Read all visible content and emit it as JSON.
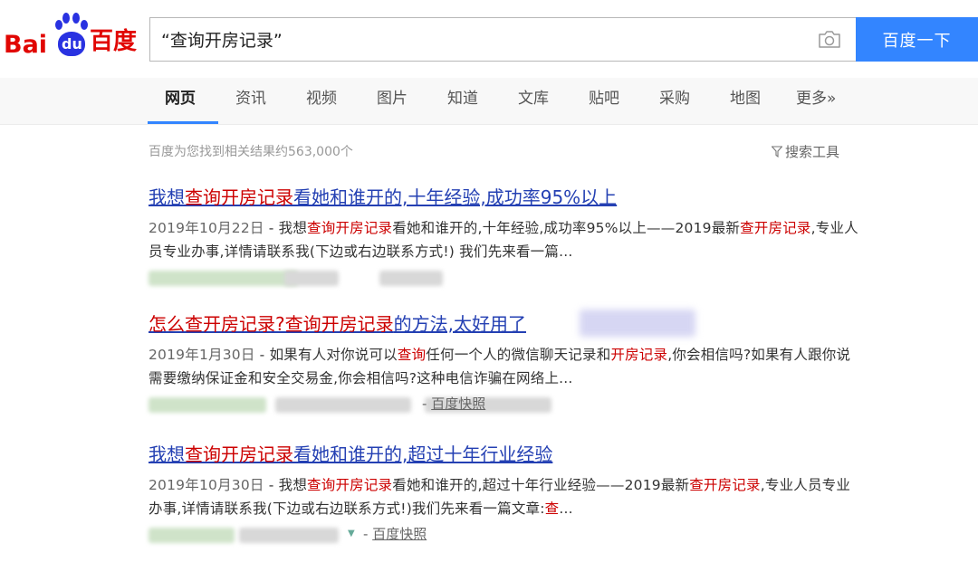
{
  "logo": {
    "bai": "Bai",
    "du": "du",
    "cn": "百度"
  },
  "search": {
    "query": "“查询开房记录”",
    "button": "百度一下"
  },
  "tabs": [
    "网页",
    "资讯",
    "视频",
    "图片",
    "知道",
    "文库",
    "贴吧",
    "采购",
    "地图",
    "更多»"
  ],
  "result_count": "百度为您找到相关结果约563,000个",
  "tools": "搜索工具",
  "results": [
    {
      "title": [
        {
          "t": "我想",
          "em": false
        },
        {
          "t": "查询开房记录",
          "em": true
        },
        {
          "t": "看她和谁开的,十年经验,成功率95%以上",
          "em": false
        }
      ],
      "date": "2019年10月22日",
      "abstract": [
        {
          "t": " - 我想",
          "em": false
        },
        {
          "t": "查询开房记录",
          "em": true
        },
        {
          "t": "看她和谁开的,十年经验,成功率95%以上——2019最新",
          "em": false
        },
        {
          "t": "查开房记录",
          "em": true
        },
        {
          "t": ",专业人员专业办事,详情请联系我(下边或右边联系方式!) 我们先来看一篇...",
          "em": false
        }
      ],
      "snapshot": ""
    },
    {
      "title": [
        {
          "t": "怎么查开房记录?查询开房记录",
          "em": true
        },
        {
          "t": "的方法,太好用了",
          "em": false
        }
      ],
      "date": "2019年1月30日",
      "abstract": [
        {
          "t": " - 如果有人对你说可以",
          "em": false
        },
        {
          "t": "查询",
          "em": true
        },
        {
          "t": "任何一个人的微信聊天记录和",
          "em": false
        },
        {
          "t": "开房记录",
          "em": true
        },
        {
          "t": ",你会相信吗?如果有人跟你说需要缴纳保证金和安全交易金,你会相信吗?这种电信诈骗在网络上...",
          "em": false
        }
      ],
      "snapshot": "百度快照"
    },
    {
      "title": [
        {
          "t": "我想",
          "em": false
        },
        {
          "t": "查询开房记录",
          "em": true
        },
        {
          "t": "看她和谁开的,超过十年行业经验",
          "em": false
        }
      ],
      "date": "2019年10月30日",
      "abstract": [
        {
          "t": " - 我想",
          "em": false
        },
        {
          "t": "查询开房记录",
          "em": true
        },
        {
          "t": "看她和谁开的,超过十年行业经验——2019最新",
          "em": false
        },
        {
          "t": "查开房记录",
          "em": true
        },
        {
          "t": ",专业人员专业办事,详情请联系我(下边或右边联系方式!)我们先来看一篇文章:",
          "em": false
        },
        {
          "t": "查",
          "em": true
        },
        {
          "t": "...",
          "em": false
        }
      ],
      "snapshot": "百度快照"
    }
  ],
  "colors": {
    "brand_red": "#e10602",
    "brand_blue": "#2932e1",
    "button": "#3385ff",
    "link": "#2440b3",
    "highlight": "#c00"
  }
}
